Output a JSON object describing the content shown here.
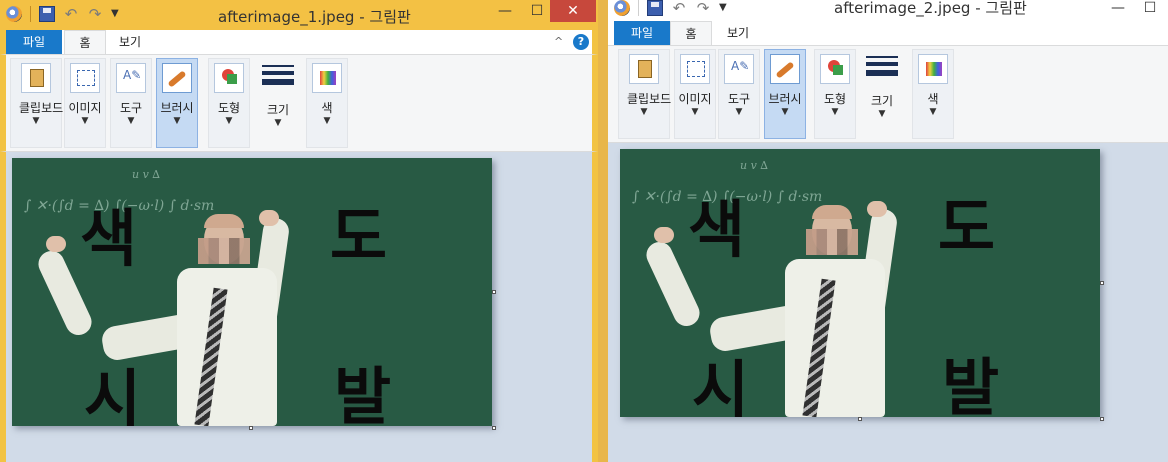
{
  "windows": [
    {
      "title": "afterimage_1.jpeg - 그림판",
      "tabs": {
        "file": "파일",
        "home": "홈",
        "view": "보기"
      },
      "groups": [
        "클립보드",
        "이미지",
        "도구",
        "브러시",
        "도형",
        "크기",
        "색"
      ],
      "overlay_text": [
        "색",
        "도",
        "시",
        "발"
      ]
    },
    {
      "title": "afterimage_2.jpeg - 그림판",
      "tabs": {
        "file": "파일",
        "home": "홈",
        "view": "보기"
      },
      "groups": [
        "클립보드",
        "이미지",
        "도구",
        "브러시",
        "도형",
        "크기",
        "색"
      ],
      "overlay_text": [
        "색",
        "도",
        "시",
        "발"
      ]
    }
  ],
  "controls": {
    "minimize": "—",
    "maximize": "☐",
    "close": "✕",
    "collapse": "^",
    "help": "?"
  },
  "colors": {
    "accent": "#1979ca",
    "window_frame_1": "#f3c144",
    "canvas_bg": "#d1dbe8",
    "chalkboard": "#285a44"
  },
  "icons": [
    "paint-app-icon",
    "save-icon",
    "undo-icon",
    "redo-icon",
    "clipboard-icon",
    "select-icon",
    "tools-icon",
    "brush-icon",
    "shapes-icon",
    "size-icon",
    "color-icon"
  ]
}
